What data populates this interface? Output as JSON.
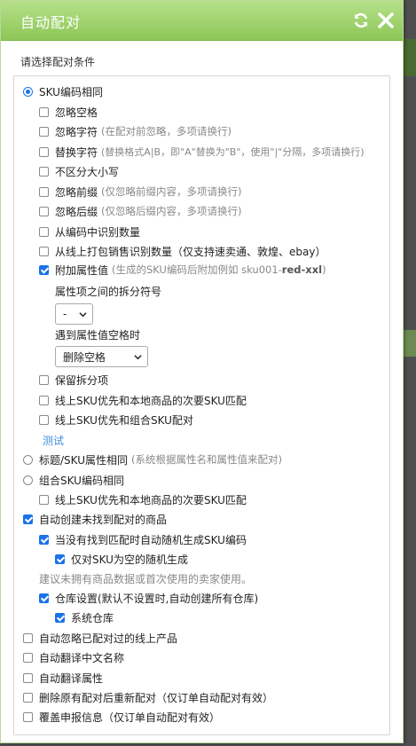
{
  "dialog": {
    "title": "自动配对",
    "subtitle": "请选择配对条件"
  },
  "sku_same": {
    "label": "SKU编码相同",
    "checked": true,
    "options": [
      {
        "label": "忽略空格",
        "hint": "",
        "checked": false
      },
      {
        "label": "忽略字符",
        "hint": "(在配对前忽略，多项请换行)",
        "checked": false
      },
      {
        "label": "替换字符",
        "hint": "(替换格式A|B，即\"A\"替换为\"B\"，使用\"|\"分隔，多项请换行)",
        "checked": false
      },
      {
        "label": "不区分大小写",
        "hint": "",
        "checked": false
      },
      {
        "label": "忽略前缀",
        "hint": "(仅忽略前缀内容，多项请换行)",
        "checked": false
      },
      {
        "label": "忽略后缀",
        "hint": "(仅忽略后缀内容，多项请换行)",
        "checked": false
      },
      {
        "label": "从编码中识别数量",
        "hint": "",
        "checked": false
      },
      {
        "label": "从线上打包销售识别数量（仅支持速卖通、敦煌、ebay）",
        "hint": "",
        "checked": false
      }
    ],
    "attr": {
      "label": "附加属性值",
      "hint_prefix": "(生成的SKU编码后附加例如 sku001-",
      "hint_bold": "red-xxl",
      "hint_suffix": ")",
      "checked": true,
      "separator_label": "属性项之间的拆分符号",
      "separator_value": "-",
      "space_label": "遇到属性值空格时",
      "space_value": "删除空格"
    },
    "tail_options": [
      {
        "label": "保留拆分项",
        "checked": false
      },
      {
        "label": "线上SKU优先和本地商品的次要SKU匹配",
        "checked": false
      },
      {
        "label": " 线上SKU优先和组合SKU配对",
        "checked": false
      }
    ],
    "test_link": "测试"
  },
  "title_attr": {
    "label": "标题/SKU属性相同",
    "hint": "(系统根据属性名和属性值来配对)",
    "checked": false
  },
  "combo": {
    "label": "组合SKU编码相同",
    "checked": false,
    "sub_option": {
      "label": "线上SKU优先和本地商品的次要SKU匹配",
      "checked": false
    }
  },
  "auto_create": {
    "label": "自动创建未找到配对的商品",
    "checked": true,
    "gen_sku": {
      "label": "当没有找到匹配时自动随机生成SKU编码",
      "checked": true
    },
    "empty_only": {
      "label": "仅对SKU为空的随机生成",
      "checked": true
    },
    "note": "建议未拥有商品数据或首次使用的卖家使用。",
    "warehouse": {
      "label": "仓库设置(默认不设置时,自动创建所有仓库)",
      "checked": true
    },
    "system_wh": {
      "label": "系统仓库",
      "checked": true
    }
  },
  "bottom_options": [
    {
      "label": "自动忽略已配对过的线上产品",
      "checked": false
    },
    {
      "label": "自动翻译中文名称",
      "checked": false
    },
    {
      "label": "自动翻译属性",
      "checked": false
    },
    {
      "label": "删除原有配对后重新配对（仅订单自动配对有效）",
      "checked": false
    },
    {
      "label": "覆盖申报信息（仅订单自动配对有效）",
      "checked": false
    }
  ],
  "icons": {
    "refresh": "refresh-icon",
    "close": "close-icon",
    "chevron": "chevron-down-icon"
  },
  "colors": {
    "title_bar": "#8dc657",
    "accent": "#1a73e8",
    "link": "#3c8dde"
  }
}
